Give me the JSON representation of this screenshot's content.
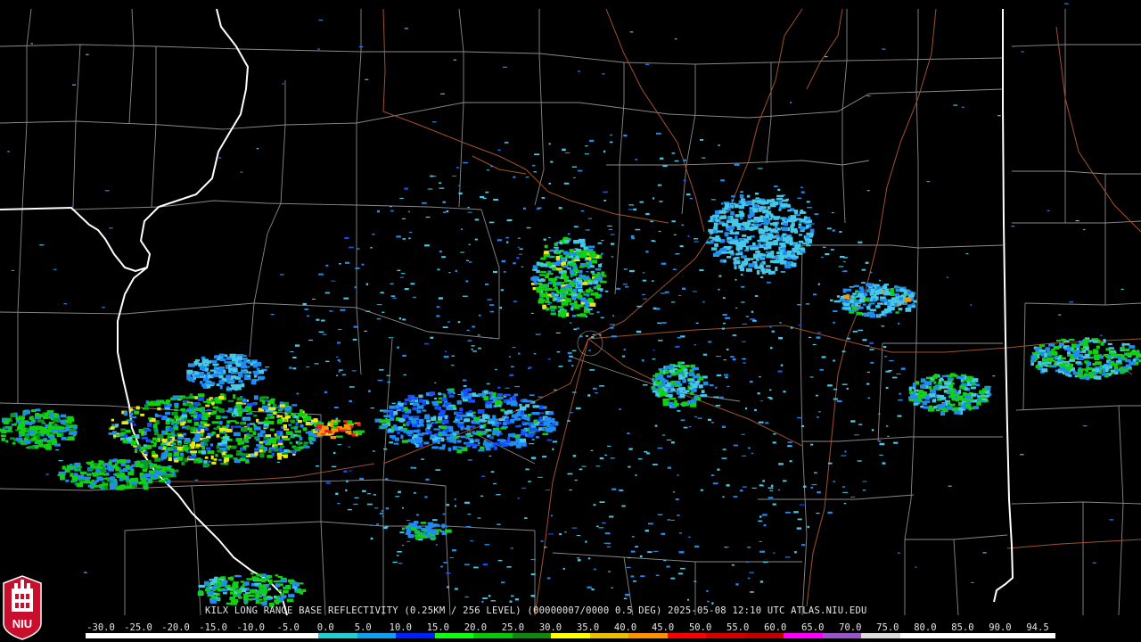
{
  "product_label": "KILX LONG RANGE BASE REFLECTIVITY (0.25KM / 256 LEVEL) (00000007/0000 0.5 DEG) 2025-05-08 12:10 UTC  ATLAS.NIU.EDU",
  "logo": {
    "text": "NIU",
    "icon": "niu-logo-icon"
  },
  "radar_site_icon": "radar-site-center-icon",
  "scale_labels": [
    "-30.0",
    "-25.0",
    "-20.0",
    "-15.0",
    "-10.0",
    "-5.0",
    "0.0",
    "5.0",
    "10.0",
    "15.0",
    "20.0",
    "25.0",
    "30.0",
    "35.0",
    "40.0",
    "45.0",
    "50.0",
    "55.0",
    "60.0",
    "65.0",
    "70.0",
    "75.0",
    "80.0",
    "85.0",
    "90.0",
    "94.5"
  ],
  "scale_colors": [
    "#ffffff",
    "#ffffff",
    "#ffffff",
    "#ffffff",
    "#ffffff",
    "#ffffff",
    "#20d0d0",
    "#10a0f0",
    "#0020ff",
    "#10ff10",
    "#08c808",
    "#108810",
    "#ffff00",
    "#e8c000",
    "#ff9000",
    "#ff0000",
    "#d40000",
    "#c00000",
    "#ff00ff",
    "#9855c8",
    "#dcdcdc",
    "#ffffff",
    "#ffffff",
    "#ffffff",
    "#ffffff"
  ],
  "map_colors": {
    "background": "#000000",
    "county_lines": "#8a8a8a",
    "state_lines": "#ffffff",
    "roads": "#a0522d"
  },
  "echo_colors": {
    "light": "#46c8e8",
    "mid": "#1e8cf0",
    "blue": "#1450ff",
    "green": "#12d012",
    "dark_green": "#0a9a20",
    "yellow": "#f0e614",
    "orange": "#ff9600",
    "red": "#e61e1e"
  }
}
